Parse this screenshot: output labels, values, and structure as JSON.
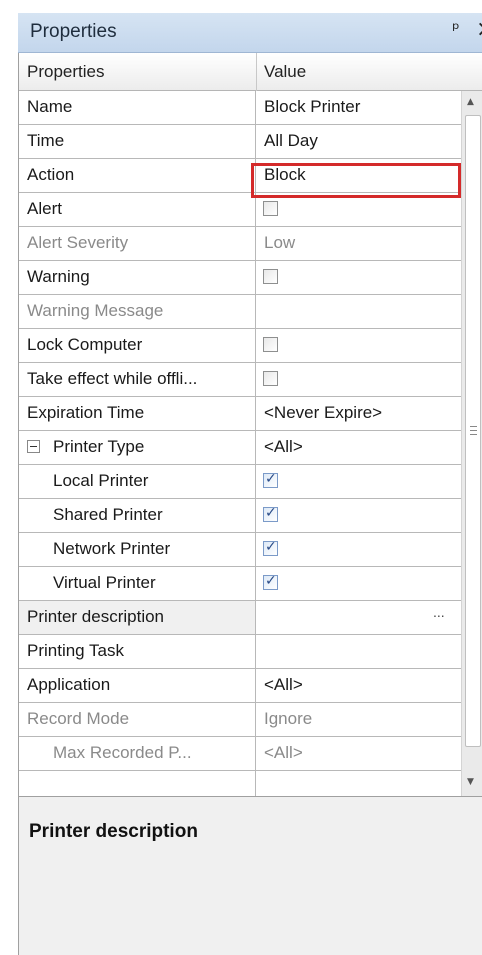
{
  "window": {
    "title": "Properties",
    "pin_icon": "pin-icon",
    "close_icon": "close-icon"
  },
  "grid": {
    "columns": [
      "Properties",
      "Value"
    ],
    "rows": [
      {
        "name": "Name",
        "value": "Block Printer",
        "type": "text"
      },
      {
        "name": "Time",
        "value": "All Day",
        "type": "text"
      },
      {
        "name": "Action",
        "value": "Block",
        "type": "text",
        "highlighted": true
      },
      {
        "name": "Alert",
        "value": "",
        "type": "checkbox",
        "checked": false
      },
      {
        "name": "Alert Severity",
        "value": "Low",
        "type": "text",
        "disabled": true
      },
      {
        "name": "Warning",
        "value": "",
        "type": "checkbox",
        "checked": false
      },
      {
        "name": "Warning Message",
        "value": "",
        "type": "text",
        "disabled": true
      },
      {
        "name": "Lock Computer",
        "value": "",
        "type": "checkbox",
        "checked": false
      },
      {
        "name": "Take effect while offli...",
        "value": "",
        "type": "checkbox",
        "checked": false
      },
      {
        "name": "Expiration Time",
        "value": "<Never Expire>",
        "type": "text"
      },
      {
        "name": "Printer Type",
        "value": "<All>",
        "type": "text",
        "expandable": true
      },
      {
        "name": "Local Printer",
        "value": "",
        "type": "checkbox",
        "checked": true,
        "indent": 1
      },
      {
        "name": "Shared Printer",
        "value": "",
        "type": "checkbox",
        "checked": true,
        "indent": 1
      },
      {
        "name": "Network Printer",
        "value": "",
        "type": "checkbox",
        "checked": true,
        "indent": 1
      },
      {
        "name": "Virtual Printer",
        "value": "",
        "type": "checkbox",
        "checked": true,
        "indent": 1
      },
      {
        "name": "Printer description",
        "value": "...",
        "type": "ellipsis",
        "selected": true
      },
      {
        "name": "Printing Task",
        "value": "",
        "type": "text"
      },
      {
        "name": "Application",
        "value": "<All>",
        "type": "text"
      },
      {
        "name": "Record Mode",
        "value": "Ignore",
        "type": "text",
        "disabled": true
      },
      {
        "name": "Max Recorded P...",
        "value": "<All>",
        "type": "text",
        "disabled": true,
        "indent": 1
      },
      {
        "name": "",
        "value": "",
        "type": "text"
      }
    ]
  },
  "description": {
    "title": "Printer description"
  },
  "colors": {
    "highlight_border": "#d42a2a",
    "title_bar": "#c9dbef"
  }
}
